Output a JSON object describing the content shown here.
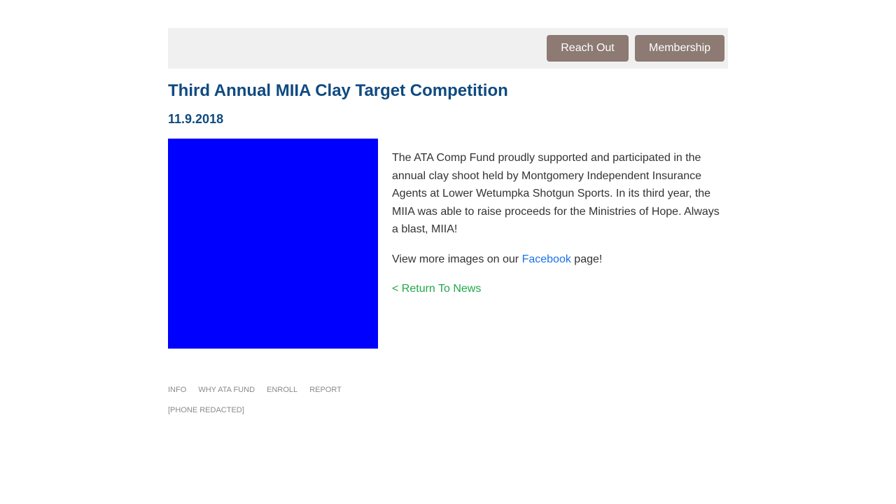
{
  "header": {
    "buttons": {
      "reach_out": "Reach Out",
      "membership": "Membership"
    }
  },
  "article": {
    "title": "Third Annual MIIA Clay Target Competition",
    "date": "11.9.2018",
    "image_color": "#0000ff",
    "paragraph": "The ATA Comp Fund proudly supported and participated in the annual clay shoot held by Montgomery Independent Insurance Agents at Lower Wetumpka Shotgun Sports. In its third year, the MIIA was able to raise proceeds for the Ministries of Hope. Always a blast, MIIA!",
    "view_more_prefix": "View more images on our ",
    "facebook_link": "Facebook",
    "view_more_suffix": " page!",
    "return_link": "< Return To News"
  },
  "footer": {
    "nav": [
      "INFO",
      "WHY ATA FUND",
      "ENROLL",
      "REPORT"
    ],
    "phone": "[PHONE REDACTED]"
  },
  "colors": {
    "heading": "#0f4a80",
    "button": "#8c7a73",
    "link": "#1a73e8",
    "return_link": "#22a84a",
    "topbar": "#f0f0f0"
  }
}
